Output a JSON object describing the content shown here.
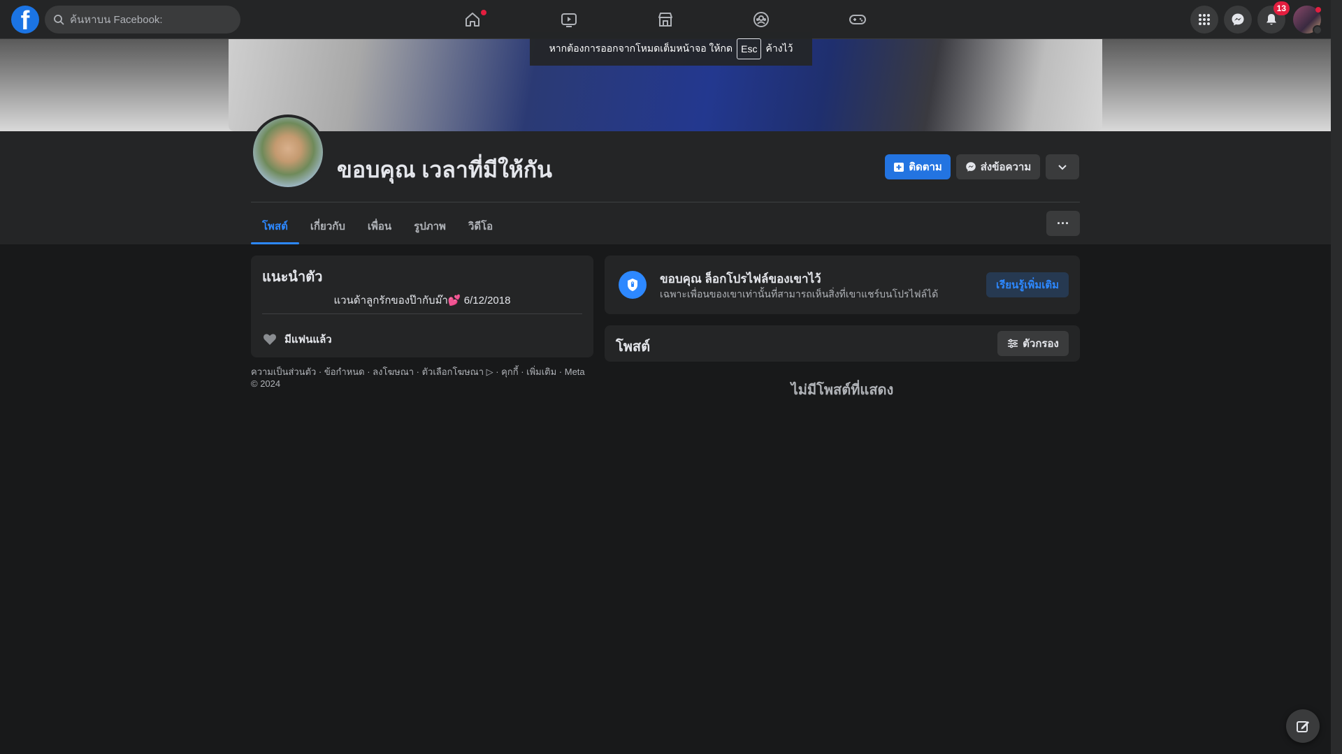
{
  "topbar": {
    "search_placeholder": "ค้นหาบน Facebook:",
    "notification_count": "13",
    "icons": [
      "facebook-logo",
      "search-icon",
      "home-icon",
      "watch-icon",
      "marketplace-icon",
      "groups-icon",
      "gaming-icon",
      "menu-grid-icon",
      "messenger-icon",
      "bell-icon",
      "avatar"
    ]
  },
  "fullscreen_toast": {
    "before": "หากต้องการออกจากโหมดเต็มหน้าจอ ให้กด",
    "key": "Esc",
    "after": "ค้างไว้"
  },
  "profile": {
    "name": "ขอบคุณ เวลาที่มีให้กัน",
    "follow_label": "ติดตาม",
    "message_label": "ส่งข้อความ"
  },
  "tabs": [
    {
      "label": "โพสต์",
      "active": true
    },
    {
      "label": "เกี่ยวกับ",
      "active": false
    },
    {
      "label": "เพื่อน",
      "active": false
    },
    {
      "label": "รูปภาพ",
      "active": false
    },
    {
      "label": "วิดีโอ",
      "active": false
    }
  ],
  "intro": {
    "title": "แนะนำตัว",
    "bio": "แวนด้าลูกรักของป๊ากับม๊า💕 6/12/2018",
    "relationship": "มีแฟนแล้ว"
  },
  "footer": {
    "line1": "ความเป็นส่วนตัว · ข้อกำหนด · ลงโฆษณา · ตัวเลือกโฆษณา ▷ · คุกกี้ · เพิ่มเติม · Meta",
    "line2": "© 2024"
  },
  "lock_notice": {
    "title": "ขอบคุณ ล็อกโปรไฟล์ของเขาไว้",
    "subtitle": "เฉพาะเพื่อนของเขาเท่านั้นที่สามารถเห็นสิ่งที่เขาแชร์บนโปรไฟล์ได้",
    "button": "เรียนรู้เพิ่มเติม"
  },
  "posts": {
    "title": "โพสต์",
    "filter_label": "ตัวกรอง",
    "empty_text": "ไม่มีโพสต์ที่แสดง"
  },
  "colors": {
    "accent": "#2d88ff",
    "background": "#18191a",
    "surface": "#242526",
    "badge": "#e41e3f"
  }
}
